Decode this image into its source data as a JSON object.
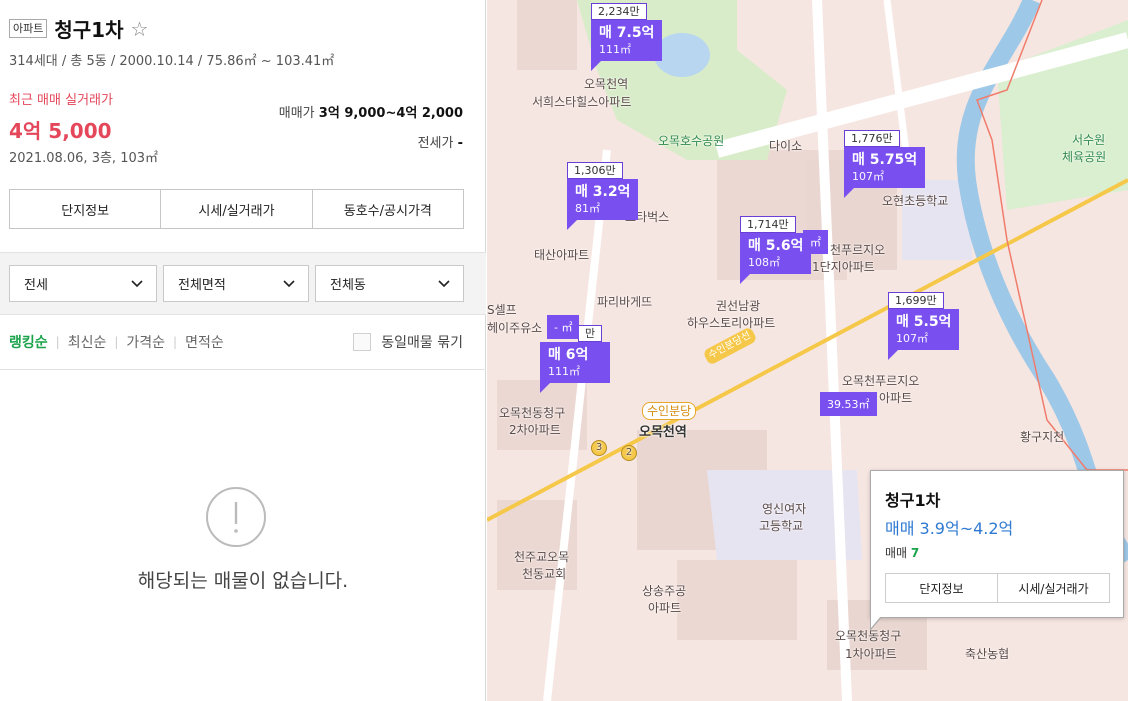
{
  "complex": {
    "type_badge": "아파트",
    "name": "청구1차",
    "star": "☆",
    "meta": "314세대 / 총 5동 / 2000.10.14 / 75.86㎡ ~ 103.41㎡",
    "recent_label": "최근 매매 실거래가",
    "recent_price": "4억 5,000",
    "recent_info": "2021.08.06, 3층, 103㎡",
    "sale_label": "매매가",
    "sale_range": "3억 9,000~4억 2,000",
    "jeonse_label": "전세가",
    "jeonse_value": "-"
  },
  "tabs": [
    "단지정보",
    "시세/실거래가",
    "동호수/공시가격"
  ],
  "filters": [
    "전세",
    "전체면적",
    "전체동"
  ],
  "sort": [
    "랭킹순",
    "최신순",
    "가격순",
    "면적순"
  ],
  "group_label": "동일매물 묶기",
  "empty_message": "해당되는 매물이 없습니다.",
  "map": {
    "labels": {
      "station1": "오목천역",
      "seohui": "서희스타힐스아파트",
      "park": "오목호수공원",
      "daiso": "다이소",
      "seosuwon": "서수원",
      "sports": "체육공원",
      "starbucks": "스타벅스",
      "taesan": "태산아파트",
      "school1": "오현초등학교",
      "prugio1": "천푸르지오",
      "prugio1b": "1단지아파트",
      "selfservice": "S셀프",
      "hiju": "헤이주유소",
      "paris": "파리바게뜨",
      "kwonsun": "권선남광",
      "kwonsun2": "하우스토리아파트",
      "prugio2": "오목천푸르지오",
      "prugio2b": "아파트",
      "cheonggu2": "오목천동청구",
      "cheonggu2b": "2차아파트",
      "station_badge": "수인분당",
      "station_main": "오목천역",
      "line_label": "수인분당선",
      "hwanggu": "황구지천",
      "youngshin": "영신여자",
      "youngshin2": "고등학교",
      "church": "천주교오목",
      "church2": "천동교회",
      "sangsong": "상송주공",
      "sangsong2": "아파트",
      "cheonggu1": "오목천동청구",
      "cheonggu1b": "1차아파트",
      "nonghyup": "축산농협",
      "line3": "3",
      "line2": "2"
    },
    "markers": [
      {
        "top": "2,234만",
        "price": "매 7.5억",
        "area": "111㎡"
      },
      {
        "top": "1,776만",
        "price": "매 5.75억",
        "area": "107㎡"
      },
      {
        "top": "1,306만",
        "price": "매 3.2억",
        "area": "81㎡"
      },
      {
        "top": "1,714만",
        "price": "매 5.6억",
        "area": "108㎡"
      },
      {
        "top": "1,699만",
        "price": "매 5.5억",
        "area": "107㎡"
      },
      {
        "top": "만",
        "price": "매 6억",
        "area": "111㎡"
      }
    ],
    "small_markers": [
      "- ㎡",
      "39.53㎡",
      "㎡"
    ]
  },
  "popup": {
    "name": "청구1차",
    "price": "매매 3.9억~4.2억",
    "count_label": "매매",
    "count": "7",
    "btn1": "단지정보",
    "btn2": "시세/실거래가"
  },
  "colors": {
    "accent_red": "#e4475a",
    "marker_purple": "#7a4ff0",
    "green": "#1aa34a",
    "blue": "#2e7ad1"
  }
}
